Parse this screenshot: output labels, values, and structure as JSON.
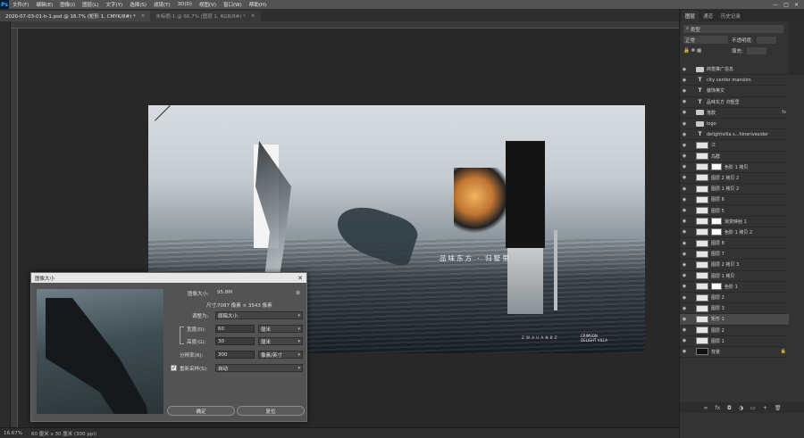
{
  "app": {
    "logo": "Ps"
  },
  "menu": [
    "文件(F)",
    "编辑(E)",
    "图像(I)",
    "图层(L)",
    "文字(Y)",
    "选择(S)",
    "滤镜(T)",
    "3D(D)",
    "视图(V)",
    "窗口(W)",
    "帮助(H)"
  ],
  "window_controls": {
    "min": "—",
    "max": "□",
    "close": "✕"
  },
  "tabs": [
    {
      "label": "2020-07-03-01-h-1.psd @ 16.7% (矩形 1, CMYK/8#) *",
      "close": "×"
    },
    {
      "label": "未标题-1 @ 66.7% (图层 1, RGB/8#) *",
      "close": "×"
    }
  ],
  "artwork": {
    "slogan": "品味东方 · 归墅里",
    "footer_note": "Z  W  A  U  A  N  B  Z",
    "footer_logo_line1": "CRIMSON",
    "footer_logo_line2": "DELIGHT VILLA"
  },
  "status": {
    "zoom": "16.67%",
    "doc_info": "60 厘米 x 30 厘米 (300 ppi)"
  },
  "dialog": {
    "title": "图像大小",
    "close": "✕",
    "image_size_label": "图像大小:",
    "image_size_value": "95.8M",
    "dimensions_label": "尺寸:",
    "dimensions_value": "7087 像素  ×  3543 像素",
    "fit_label": "调整为:",
    "fit_value": "原稿大小",
    "width_label": "宽度(D):",
    "width_value": "60",
    "width_unit": "厘米",
    "height_label": "高度(G):",
    "height_value": "30",
    "height_unit": "厘米",
    "resolution_label": "分辨率(R):",
    "resolution_value": "300",
    "resolution_unit": "像素/英寸",
    "resample_label": "重新采样(S):",
    "resample_value": "自动",
    "ok_label": "确定",
    "cancel_label": "复位"
  },
  "panel": {
    "tabs": [
      "图层",
      "通道",
      "历史记录"
    ],
    "filter_placeholder": "类型",
    "blend_mode": "正常",
    "opacity_label": "不透明度:",
    "fill_label": "填充:",
    "layers": [
      {
        "name": "商签推广信息",
        "kind": "folder"
      },
      {
        "name": "city center mansion",
        "kind": "text"
      },
      {
        "name": "装饰英文",
        "kind": "text"
      },
      {
        "name": "品味东方 归墅里",
        "kind": "text"
      },
      {
        "name": "落款",
        "kind": "folder",
        "fx": "fx"
      },
      {
        "name": "logo",
        "kind": "folder"
      },
      {
        "name": "delightvilla s...hinerivesider",
        "kind": "text"
      },
      {
        "name": "江",
        "kind": "image"
      },
      {
        "name": "鸟群",
        "kind": "image"
      },
      {
        "name": "色阶 1 拷贝",
        "kind": "adjust"
      },
      {
        "name": "图层 2 拷贝 2",
        "kind": "image"
      },
      {
        "name": "图层 1 拷贝 2",
        "kind": "image"
      },
      {
        "name": "图层 6",
        "kind": "image"
      },
      {
        "name": "图层 5",
        "kind": "image"
      },
      {
        "name": "渐变映射 1",
        "kind": "adjust"
      },
      {
        "name": "色阶 1 拷贝 2",
        "kind": "adjust"
      },
      {
        "name": "图层 8",
        "kind": "image"
      },
      {
        "name": "图层 7",
        "kind": "image"
      },
      {
        "name": "图层 2 拷贝 3",
        "kind": "image"
      },
      {
        "name": "图层 1 拷贝",
        "kind": "image"
      },
      {
        "name": "色阶 1",
        "kind": "adjust"
      },
      {
        "name": "图层 2",
        "kind": "image"
      },
      {
        "name": "图层 3",
        "kind": "image"
      },
      {
        "name": "矩形 1",
        "kind": "image",
        "selected": true
      },
      {
        "name": "图层 2",
        "kind": "image"
      },
      {
        "name": "图层 1",
        "kind": "image"
      },
      {
        "name": "背景",
        "kind": "background",
        "lock": "🔒"
      }
    ],
    "bottom_icons": [
      "∞",
      "fx",
      "◘",
      "◑",
      "▭",
      "+",
      "🗑"
    ]
  }
}
